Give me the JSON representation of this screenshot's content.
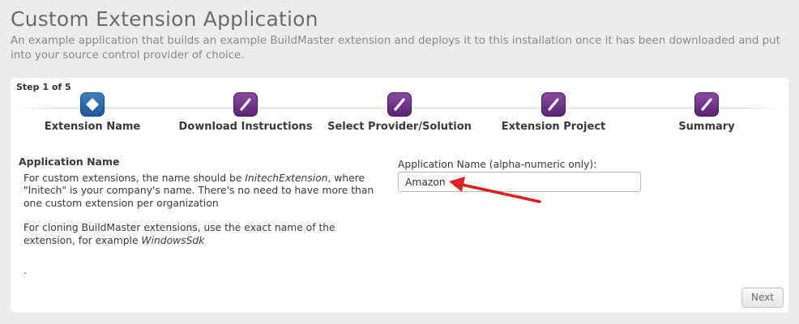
{
  "header": {
    "title": "Custom Extension Application",
    "subtitle": "An example application that builds an example BuildMaster extension and deploys it to this installation once it has been downloaded and put into your source control provider of choice."
  },
  "wizard": {
    "step_counter": "Step 1 of 5",
    "steps": [
      {
        "label": "Extension Name",
        "icon": "diamond-icon",
        "state": "active"
      },
      {
        "label": "Download Instructions",
        "icon": "pencil-icon",
        "state": "pending"
      },
      {
        "label": "Select Provider/Solution",
        "icon": "pencil-icon",
        "state": "pending"
      },
      {
        "label": "Extension Project",
        "icon": "pencil-icon",
        "state": "pending"
      },
      {
        "label": "Summary",
        "icon": "pencil-icon",
        "state": "pending"
      }
    ]
  },
  "help": {
    "heading": "Application Name",
    "p1_pre": "For custom extensions, the name should be ",
    "p1_em": "InitechExtension",
    "p1_post": ", where \"Initech\" is your company's name. There's no need to have more than one custom extension per organization",
    "p2_pre": "For cloning BuildMaster extensions, use the exact name of the extension, for example ",
    "p2_em": "WindowsSdk",
    "dot": "."
  },
  "form": {
    "label": "Application Name (alpha-numeric only):",
    "value": "Amazon"
  },
  "actions": {
    "next_label": "Next"
  },
  "colors": {
    "active_step": "#2a6aab",
    "pending_step": "#6e3386",
    "annotation_arrow": "#e02020"
  }
}
